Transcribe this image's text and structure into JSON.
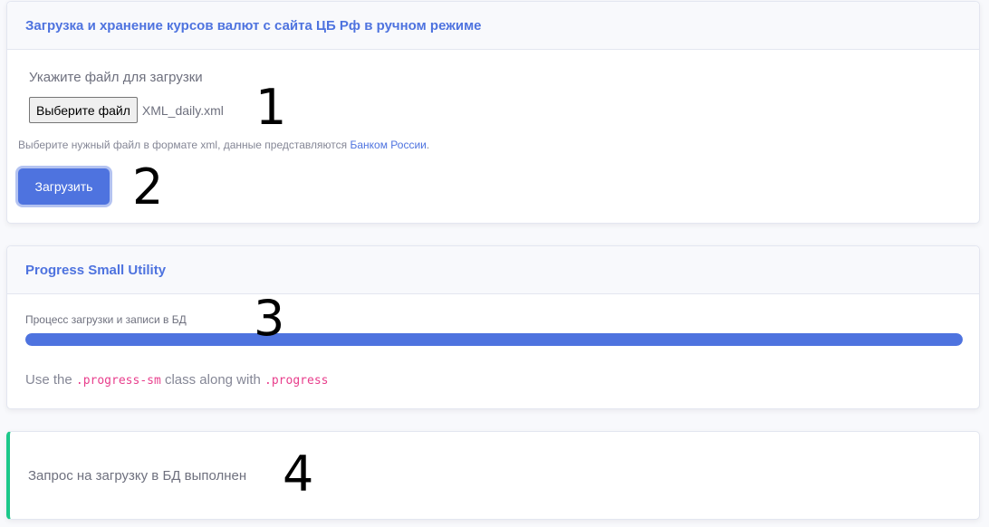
{
  "upload_card": {
    "title": "Загрузка и хранение курсов валют с сайта ЦБ Рф в ручном режиме",
    "file_label": "Укажите файл для загрузки",
    "file_button": "Выберите файл",
    "file_name": "XML_daily.xml",
    "help_prefix": "Выберите нужный файл в формате xml, данные представляются",
    "help_link": "Банком России",
    "help_suffix": ".",
    "submit_label": "Загрузить"
  },
  "progress_card": {
    "title": "Progress Small Utility",
    "label": "Процесс загрузки и записи в БД",
    "progress_percent": 100,
    "usage_prefix": "Use the",
    "usage_code1": ".progress-sm",
    "usage_middle": "class along with",
    "usage_code2": ".progress"
  },
  "status_card": {
    "text": "Запрос на загрузку в БД выполнен"
  },
  "annotations": {
    "m1": "1",
    "m2": "2",
    "m3": "3",
    "m4": "4"
  },
  "colors": {
    "primary": "#4e73df",
    "success": "#1cc88a",
    "code": "#e83e8c"
  }
}
